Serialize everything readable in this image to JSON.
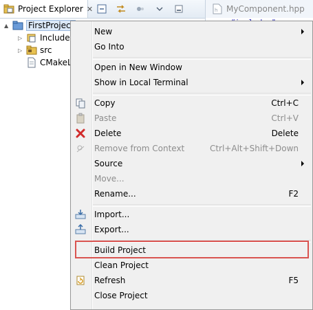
{
  "explorer": {
    "tab_label": "Project Explorer",
    "tab_close": "✕",
    "tree": [
      {
        "label": "FirstProject",
        "twisty": "▲",
        "icon": "project-folder-icon"
      },
      {
        "label": "Includes",
        "twisty": "▷",
        "icon": "includes-icon"
      },
      {
        "label": "src",
        "twisty": "▷",
        "icon": "source-folder-icon"
      },
      {
        "label": "CMakeL",
        "twisty": "",
        "icon": "file-icon"
      }
    ]
  },
  "editor": {
    "tab_label": "MyComponent.hpp",
    "code_fragment": "#include \"c"
  },
  "context_menu": {
    "items": {
      "new": {
        "label": "New"
      },
      "go_into": {
        "label": "Go Into"
      },
      "open_new_window": {
        "label": "Open in New Window"
      },
      "show_terminal": {
        "label": "Show in Local Terminal"
      },
      "copy": {
        "label": "Copy",
        "accel": "Ctrl+C"
      },
      "paste": {
        "label": "Paste",
        "accel": "Ctrl+V"
      },
      "delete": {
        "label": "Delete",
        "accel": "Delete"
      },
      "remove_context": {
        "label": "Remove from Context",
        "accel": "Ctrl+Alt+Shift+Down"
      },
      "source": {
        "label": "Source"
      },
      "move": {
        "label": "Move..."
      },
      "rename": {
        "label": "Rename...",
        "accel": "F2"
      },
      "import": {
        "label": "Import..."
      },
      "export": {
        "label": "Export..."
      },
      "build_project": {
        "label": "Build Project"
      },
      "clean_project": {
        "label": "Clean Project"
      },
      "refresh": {
        "label": "Refresh",
        "accel": "F5"
      },
      "close_project": {
        "label": "Close Project"
      }
    }
  },
  "colors": {
    "highlight_box": "#d9534f",
    "menu_background": "#f0f0f0",
    "disabled_text": "#8d8d8d"
  }
}
